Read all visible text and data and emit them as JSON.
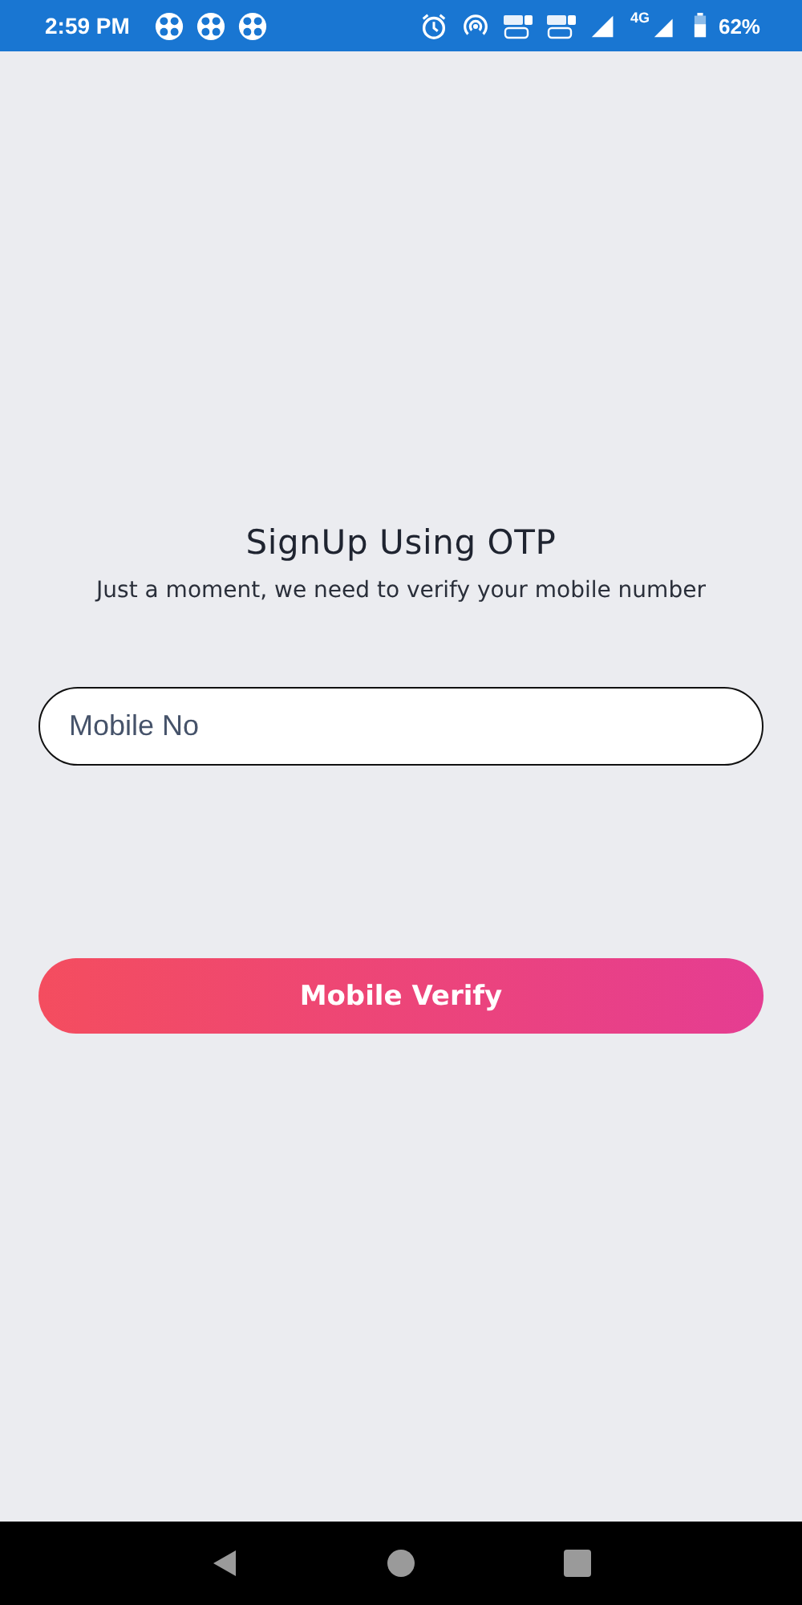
{
  "status_bar": {
    "time": "2:59 PM",
    "network": "4G",
    "battery": "62%"
  },
  "title": "SignUp Using OTP",
  "subtitle": "Just a moment, we need to verify your mobile number",
  "mobile_field": {
    "placeholder": "Mobile No"
  },
  "verify_button": {
    "label": "Mobile Verify"
  }
}
